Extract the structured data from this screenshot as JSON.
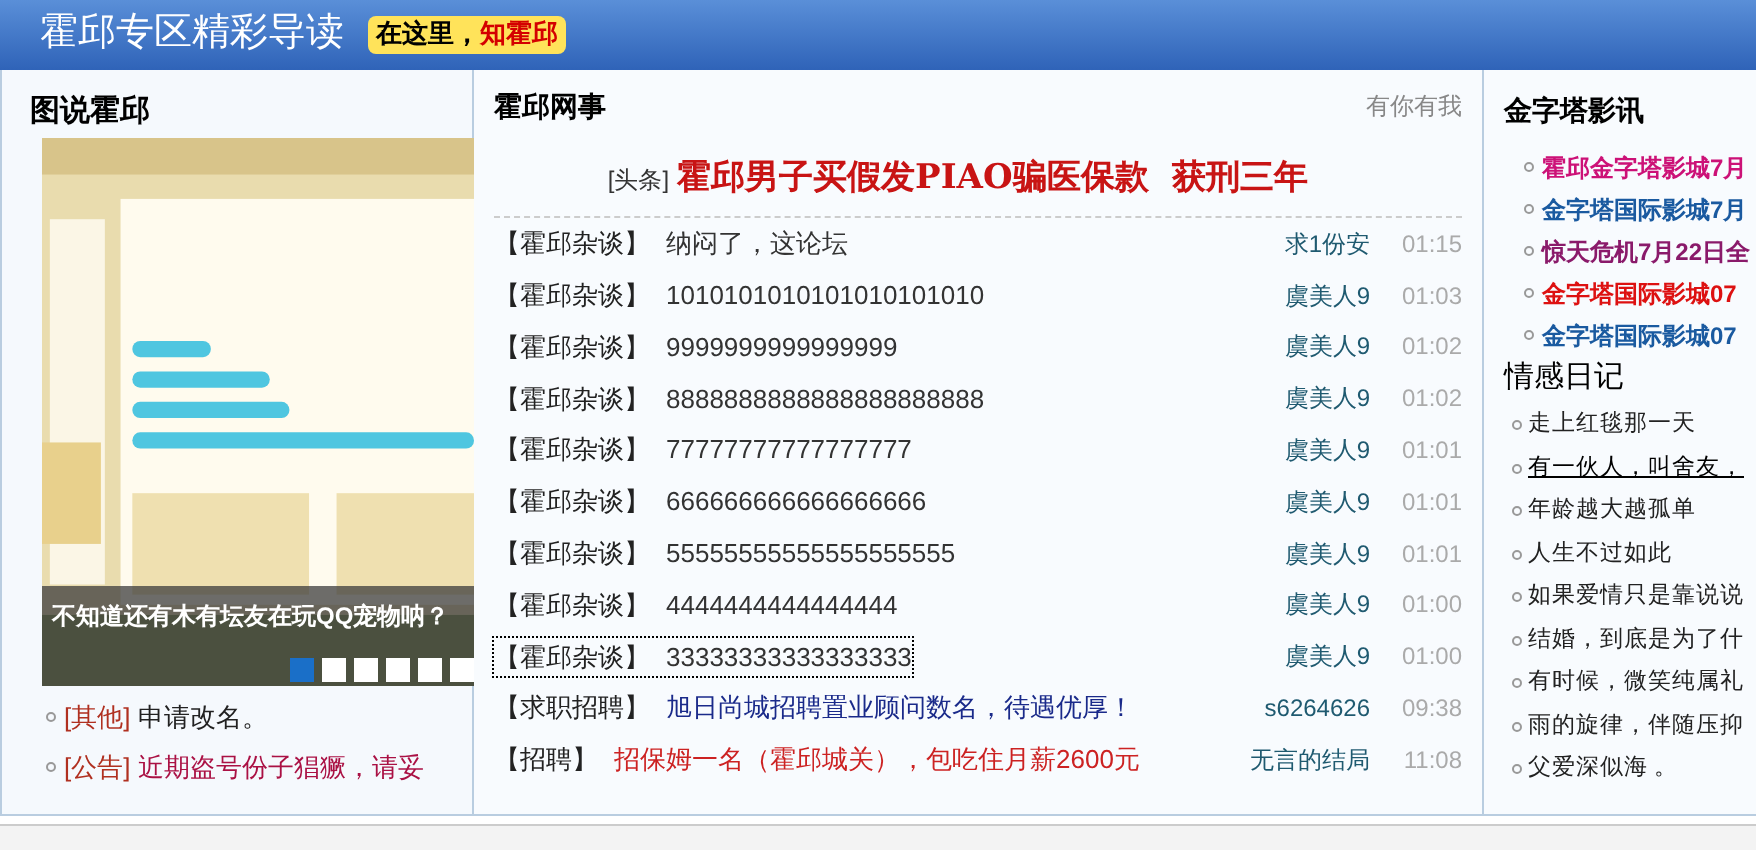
{
  "header": {
    "title": "霍邱专区精彩导读",
    "slogan_prefix": "在这里，",
    "slogan_highlight": "知霍邱"
  },
  "left": {
    "title": "图说霍邱",
    "slideshow": {
      "kind": "picture",
      "caption": "不知道还有木有坛友在玩QQ宠物呐？",
      "dots": [
        {
          "selected": true
        },
        {
          "selected": false
        },
        {
          "selected": false
        },
        {
          "selected": false
        },
        {
          "selected": false
        },
        {
          "selected": false
        }
      ]
    },
    "notices": [
      {
        "tag": "[其他]",
        "text": "申请改名。",
        "color": "#222222"
      },
      {
        "tag": "[公告]",
        "text": "近期盗号份子猖獗，请妥",
        "color": "#aa1144"
      }
    ]
  },
  "middle": {
    "title": "霍邱网事",
    "more": "有你有我",
    "headline": {
      "tag": "[头条]",
      "text": "霍邱男子买假发PIAO骗医保款  获刑三年"
    },
    "rows": [
      {
        "category": "【霍邱杂谈】",
        "title": "纳闷了，这论坛",
        "color": "#333333",
        "author": "求1份安",
        "time": "01:15",
        "focused": false
      },
      {
        "category": "【霍邱杂谈】",
        "title": "1010101010101010101010",
        "color": "#333333",
        "author": "虞美人9",
        "time": "01:03",
        "focused": false
      },
      {
        "category": "【霍邱杂谈】",
        "title": "9999999999999999",
        "color": "#333333",
        "author": "虞美人9",
        "time": "01:02",
        "focused": false
      },
      {
        "category": "【霍邱杂谈】",
        "title": "8888888888888888888888",
        "color": "#333333",
        "author": "虞美人9",
        "time": "01:02",
        "focused": false
      },
      {
        "category": "【霍邱杂谈】",
        "title": "77777777777777777",
        "color": "#333333",
        "author": "虞美人9",
        "time": "01:01",
        "focused": false
      },
      {
        "category": "【霍邱杂谈】",
        "title": "666666666666666666",
        "color": "#333333",
        "author": "虞美人9",
        "time": "01:01",
        "focused": false
      },
      {
        "category": "【霍邱杂谈】",
        "title": "55555555555555555555",
        "color": "#333333",
        "author": "虞美人9",
        "time": "01:01",
        "focused": false
      },
      {
        "category": "【霍邱杂谈】",
        "title": "4444444444444444",
        "color": "#333333",
        "author": "虞美人9",
        "time": "01:00",
        "focused": false
      },
      {
        "category": "【霍邱杂谈】",
        "title": "33333333333333333",
        "color": "#333333",
        "author": "虞美人9",
        "time": "01:00",
        "focused": true
      },
      {
        "category": "【求职招聘】",
        "title": "旭日尚城招聘置业顾问数名，待遇优厚！",
        "color": "#1a2a8a",
        "author": "s6264626",
        "time": "09:38",
        "focused": false
      },
      {
        "category": "【招聘】",
        "title": "招保姆一名（霍邱城关），包吃住月薪2600元",
        "color": "#cc2222",
        "author": "无言的结局",
        "time": "11:08",
        "focused": false
      }
    ]
  },
  "right": {
    "title": "金字塔影讯",
    "movies": [
      {
        "text": "霍邱金字塔影城7月",
        "color": "#cc1177"
      },
      {
        "text": "金字塔国际影城7月",
        "color": "#1a5aa0"
      },
      {
        "text": "惊天危机7月22日全",
        "color": "#8a1a6a"
      },
      {
        "text": "金字塔国际影城07",
        "color": "#dd1111"
      },
      {
        "text": "金字塔国际影城07",
        "color": "#1a5aa0"
      }
    ],
    "diary_title": "情感日记",
    "diary": [
      {
        "text": "走上红毯那一天",
        "hovered": false
      },
      {
        "text": "有一伙人，叫舍友，",
        "hovered": true
      },
      {
        "text": "年龄越大越孤单",
        "hovered": false
      },
      {
        "text": "人生不过如此",
        "hovered": false
      },
      {
        "text": "如果爱情只是靠说说",
        "hovered": false
      },
      {
        "text": "结婚，到底是为了什",
        "hovered": false
      },
      {
        "text": "有时候，微笑纯属礼",
        "hovered": false
      },
      {
        "text": "雨的旋律，伴随压抑",
        "hovered": false
      },
      {
        "text": "父爱深似海 。",
        "hovered": false
      }
    ]
  }
}
